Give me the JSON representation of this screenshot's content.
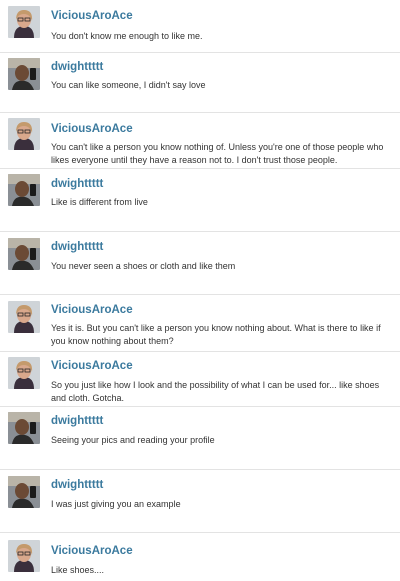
{
  "messages": [
    {
      "author": "ViciousAroAce",
      "avatar": "woman-glasses-avatar",
      "text": "You don't know me enough to like me."
    },
    {
      "author": "dwighttttt",
      "avatar": "man-selfie-avatar",
      "text": "You can like someone, I didn't say love"
    },
    {
      "author": "ViciousAroAce",
      "avatar": "woman-glasses-avatar",
      "text": "You can't like a person you know nothing of. Unless you're one of those people who likes everyone until they have a reason not to. I don't trust those people."
    },
    {
      "author": "dwighttttt",
      "avatar": "man-selfie-avatar",
      "text": "Like is different from live"
    },
    {
      "author": "dwighttttt",
      "avatar": "man-selfie-avatar",
      "text": "You never seen a shoes or cloth and like them"
    },
    {
      "author": "ViciousAroAce",
      "avatar": "woman-glasses-avatar",
      "text": "Yes it is. But you can't like a person you know nothing about. What is there to like if you know nothing about them?"
    },
    {
      "author": "ViciousAroAce",
      "avatar": "woman-glasses-avatar",
      "text": "So you just like how I look and the possibility of what I can be used for... like shoes and cloth. Gotcha."
    },
    {
      "author": "dwighttttt",
      "avatar": "man-selfie-avatar",
      "text": "Seeing your pics and reading your profile"
    },
    {
      "author": "dwighttttt",
      "avatar": "man-selfie-avatar",
      "text": "I was just giving you an example"
    },
    {
      "author": "ViciousAroAce",
      "avatar": "woman-glasses-avatar",
      "text": "Like shoes...."
    }
  ],
  "colors": {
    "username": "#3b7a9e",
    "message_text": "#333333",
    "divider": "#e3e3e3"
  }
}
